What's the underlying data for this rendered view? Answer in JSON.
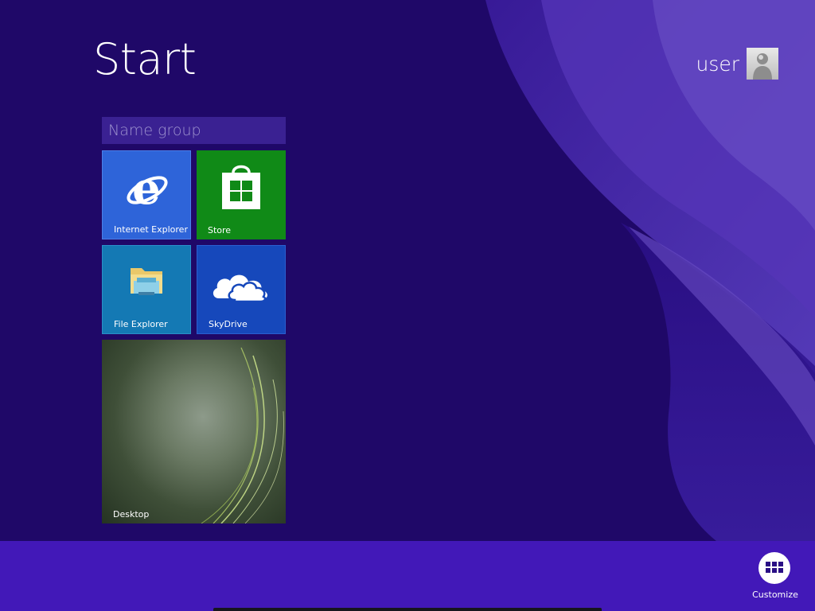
{
  "screen": {
    "title": "Start"
  },
  "user": {
    "name": "user",
    "avatar_icon": "user-avatar-icon"
  },
  "group": {
    "placeholder": "Name group"
  },
  "tiles": [
    {
      "label": "Internet Explorer",
      "icon": "internet-explorer-icon",
      "color": "#2e64d9"
    },
    {
      "label": "Store",
      "icon": "store-icon",
      "color": "#108a17"
    },
    {
      "label": "File Explorer",
      "icon": "file-explorer-icon",
      "color": "#1479b4"
    },
    {
      "label": "SkyDrive",
      "icon": "skydrive-cloud-icon",
      "color": "#1648bb"
    },
    {
      "label": "Desktop",
      "icon": "desktop-wallpaper",
      "color": "#4f5e48"
    }
  ],
  "taskbar": {
    "customize_label": "Customize",
    "customize_icon": "customize-grid-icon"
  },
  "colors": {
    "background": "#1f0868",
    "swirl": "#4a2bb0",
    "app_bar": "#4218b8"
  }
}
